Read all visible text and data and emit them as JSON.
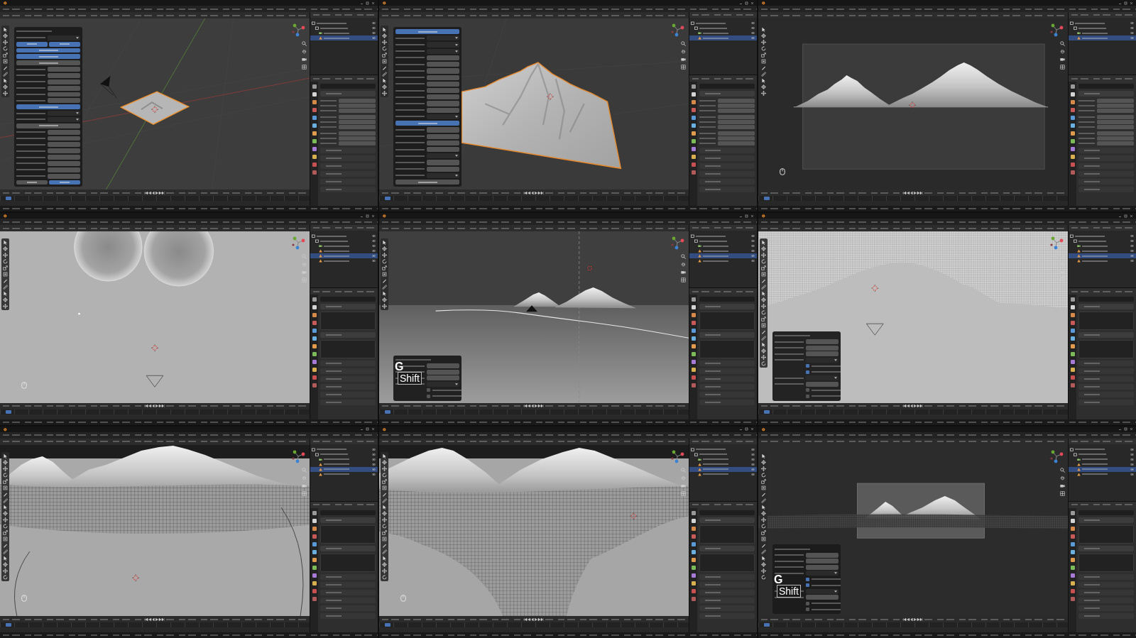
{
  "tiles": [
    {
      "viewport": {
        "kind": "plane"
      },
      "toolbar": {
        "kind": "object"
      },
      "properties": {
        "kind": "object"
      },
      "outliner": [
        {
          "kind": "collection",
          "selected": false,
          "children": [
            {
              "kind": "collection",
              "selected": false,
              "children": [
                {
                  "kind": "camera",
                  "selected": false
                },
                {
                  "kind": "mesh",
                  "selected": true
                }
              ]
            }
          ]
        }
      ],
      "panel": {
        "kind": "docked",
        "rows": [
          {
            "kind": "title"
          },
          {
            "kind": "dropdown"
          },
          {
            "kind": "pair",
            "on": [
              true,
              true
            ]
          },
          {
            "kind": "button",
            "on": true
          },
          {
            "kind": "button",
            "on": true
          },
          {
            "kind": "button",
            "on": false
          },
          {
            "kind": "field"
          },
          {
            "kind": "field"
          },
          {
            "kind": "field"
          },
          {
            "kind": "field"
          },
          {
            "kind": "field"
          },
          {
            "kind": "field"
          },
          {
            "kind": "button",
            "on": true
          },
          {
            "kind": "dropdown"
          },
          {
            "kind": "dropdown"
          },
          {
            "kind": "button",
            "on": false
          },
          {
            "kind": "field"
          },
          {
            "kind": "field"
          },
          {
            "kind": "field"
          },
          {
            "kind": "field"
          },
          {
            "kind": "field"
          },
          {
            "kind": "field"
          },
          {
            "kind": "field"
          },
          {
            "kind": "field"
          },
          {
            "kind": "pair",
            "on": [
              false,
              true
            ]
          }
        ]
      }
    },
    {
      "viewport": {
        "kind": "terrain"
      },
      "toolbar": {
        "kind": "object"
      },
      "properties": {
        "kind": "object"
      },
      "outliner": [
        {
          "kind": "collection",
          "selected": false,
          "children": [
            {
              "kind": "collection",
              "selected": false,
              "children": [
                {
                  "kind": "camera",
                  "selected": false
                },
                {
                  "kind": "mesh",
                  "selected": true
                }
              ]
            }
          ]
        }
      ],
      "panel": {
        "kind": "docked",
        "rows": [
          {
            "kind": "button",
            "on": true
          },
          {
            "kind": "dropdown"
          },
          {
            "kind": "dropdown"
          },
          {
            "kind": "dropdown"
          },
          {
            "kind": "field"
          },
          {
            "kind": "field"
          },
          {
            "kind": "field"
          },
          {
            "kind": "field"
          },
          {
            "kind": "field"
          },
          {
            "kind": "field"
          },
          {
            "kind": "field"
          },
          {
            "kind": "field"
          },
          {
            "kind": "field"
          },
          {
            "kind": "dropdown"
          },
          {
            "kind": "button",
            "on": true
          },
          {
            "kind": "field"
          },
          {
            "kind": "field"
          },
          {
            "kind": "field"
          },
          {
            "kind": "field"
          },
          {
            "kind": "dropdown"
          },
          {
            "kind": "field"
          },
          {
            "kind": "field"
          },
          {
            "kind": "dropdown"
          },
          {
            "kind": "button",
            "on": false
          }
        ]
      }
    },
    {
      "viewport": {
        "kind": "camera",
        "cursor_hint": true
      },
      "toolbar": {
        "kind": "object"
      },
      "properties": {
        "kind": "object"
      },
      "outliner": [
        {
          "kind": "collection",
          "selected": false,
          "children": [
            {
              "kind": "collection",
              "selected": false,
              "children": [
                {
                  "kind": "camera",
                  "selected": false
                },
                {
                  "kind": "mesh",
                  "selected": true
                }
              ]
            }
          ]
        }
      ]
    },
    {
      "viewport": {
        "kind": "top",
        "cursor_hint": true
      },
      "toolbar": {
        "kind": "object"
      },
      "properties": {
        "kind": "mesh-data"
      },
      "outliner": [
        {
          "kind": "collection",
          "selected": false,
          "children": [
            {
              "kind": "collection",
              "selected": false,
              "children": [
                {
                  "kind": "camera",
                  "selected": false
                },
                {
                  "kind": "mesh",
                  "selected": false
                },
                {
                  "kind": "mesh",
                  "selected": true
                },
                {
                  "kind": "mesh",
                  "selected": false
                }
              ]
            }
          ]
        }
      ]
    },
    {
      "viewport": {
        "kind": "horizon"
      },
      "toolbar": {
        "kind": "object"
      },
      "properties": {
        "kind": "mesh-data"
      },
      "outliner": [
        {
          "kind": "collection",
          "selected": false,
          "children": [
            {
              "kind": "collection",
              "selected": false,
              "children": [
                {
                  "kind": "camera",
                  "selected": false
                },
                {
                  "kind": "mesh",
                  "selected": false
                },
                {
                  "kind": "mesh",
                  "selected": true
                },
                {
                  "kind": "mesh",
                  "selected": false
                }
              ]
            }
          ]
        }
      ],
      "panel": {
        "kind": "floating",
        "rows": [
          {
            "kind": "title"
          },
          {
            "kind": "field"
          },
          {
            "kind": "field"
          },
          {
            "kind": "field"
          },
          {
            "kind": "dropdown"
          },
          {
            "kind": "check",
            "checked": false
          },
          {
            "kind": "check",
            "checked": false
          }
        ]
      },
      "keys": [
        {
          "label": "G",
          "kind": "letter"
        },
        {
          "label": "Shift",
          "kind": "key"
        }
      ]
    },
    {
      "viewport": {
        "kind": "slope"
      },
      "toolbar": {
        "kind": "edit"
      },
      "properties": {
        "kind": "mesh-data"
      },
      "outliner": [
        {
          "kind": "collection",
          "selected": false,
          "children": [
            {
              "kind": "collection",
              "selected": false,
              "children": [
                {
                  "kind": "camera",
                  "selected": false
                },
                {
                  "kind": "mesh",
                  "selected": false
                },
                {
                  "kind": "mesh",
                  "selected": true
                },
                {
                  "kind": "mesh",
                  "selected": false
                }
              ]
            }
          ]
        }
      ],
      "panel": {
        "kind": "floating",
        "rows": [
          {
            "kind": "title"
          },
          {
            "kind": "field"
          },
          {
            "kind": "field"
          },
          {
            "kind": "field"
          },
          {
            "kind": "dropdown"
          },
          {
            "kind": "check",
            "checked": true
          },
          {
            "kind": "check",
            "checked": true
          },
          {
            "kind": "dropdown"
          },
          {
            "kind": "field"
          },
          {
            "kind": "check",
            "checked": false
          },
          {
            "kind": "check",
            "checked": false
          }
        ]
      }
    },
    {
      "viewport": {
        "kind": "valley",
        "cursor_hint": true
      },
      "toolbar": {
        "kind": "edit"
      },
      "properties": {
        "kind": "mesh-data"
      },
      "outliner": [
        {
          "kind": "collection",
          "selected": false,
          "children": [
            {
              "kind": "collection",
              "selected": false,
              "children": [
                {
                  "kind": "camera",
                  "selected": false
                },
                {
                  "kind": "mesh",
                  "selected": false
                },
                {
                  "kind": "mesh",
                  "selected": true
                },
                {
                  "kind": "mesh",
                  "selected": false
                }
              ]
            }
          ]
        }
      ]
    },
    {
      "viewport": {
        "kind": "sheet",
        "cursor_hint": true
      },
      "toolbar": {
        "kind": "edit"
      },
      "properties": {
        "kind": "mesh-data"
      },
      "outliner": [
        {
          "kind": "collection",
          "selected": false,
          "children": [
            {
              "kind": "collection",
              "selected": false,
              "children": [
                {
                  "kind": "camera",
                  "selected": false
                },
                {
                  "kind": "mesh",
                  "selected": false
                },
                {
                  "kind": "mesh",
                  "selected": true
                },
                {
                  "kind": "mesh",
                  "selected": false
                }
              ]
            }
          ]
        }
      ]
    },
    {
      "viewport": {
        "kind": "camwire"
      },
      "toolbar": {
        "kind": "edit"
      },
      "properties": {
        "kind": "mesh-data"
      },
      "outliner": [
        {
          "kind": "collection",
          "selected": false,
          "children": [
            {
              "kind": "collection",
              "selected": false,
              "children": [
                {
                  "kind": "camera",
                  "selected": false
                },
                {
                  "kind": "mesh",
                  "selected": false
                },
                {
                  "kind": "mesh",
                  "selected": true
                },
                {
                  "kind": "mesh",
                  "selected": false
                }
              ]
            }
          ]
        }
      ],
      "panel": {
        "kind": "floating",
        "rows": [
          {
            "kind": "title"
          },
          {
            "kind": "field"
          },
          {
            "kind": "field"
          },
          {
            "kind": "field"
          },
          {
            "kind": "dropdown"
          },
          {
            "kind": "check",
            "checked": true
          },
          {
            "kind": "check",
            "checked": true
          },
          {
            "kind": "dropdown"
          },
          {
            "kind": "field"
          },
          {
            "kind": "check",
            "checked": false
          },
          {
            "kind": "check",
            "checked": false
          }
        ]
      },
      "keys": [
        {
          "label": "G",
          "kind": "letter"
        },
        {
          "label": "Shift",
          "kind": "key"
        }
      ]
    }
  ]
}
